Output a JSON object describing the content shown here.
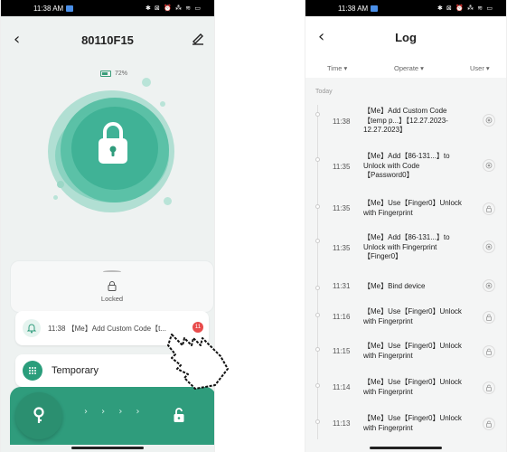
{
  "left": {
    "status": {
      "time": "11:38 AM",
      "icons": "✱ ⊠ ⏰ ⁂ ≋ ▭"
    },
    "header": {
      "title": "80110F15"
    },
    "battery": {
      "percent": "72%"
    },
    "lock_state": {
      "label": "Locked"
    },
    "latest_log": {
      "text": "11:38 【Me】Add Custom Code【t...",
      "badge": "11"
    },
    "temporary": {
      "label": "Temporary"
    },
    "unlock_bar": {
      "chevrons": "› › › ›"
    }
  },
  "right": {
    "status": {
      "time": "11:38 AM",
      "icons": "✱ ⊠ ⏰ ⁂ ≋ ▭"
    },
    "header": {
      "title": "Log"
    },
    "filters": {
      "time": "Time ▾",
      "operate": "Operate ▾",
      "user": "User ▾"
    },
    "section": "Today",
    "entries": [
      {
        "time": "11:38",
        "op": "【Me】Add Custom Code【temp p...】【12.27.2023-12.27.2023】",
        "icon": "record-icon"
      },
      {
        "time": "11:35",
        "op": "【Me】Add【86-131...】to Unlock with Code【Password0】",
        "icon": "record-icon"
      },
      {
        "time": "11:35",
        "op": "【Me】Use【Finger0】Unlock with Fingerprint",
        "icon": "unlock-icon"
      },
      {
        "time": "11:35",
        "op": "【Me】Add【86-131...】to Unlock with Fingerprint【Finger0】",
        "icon": "record-icon"
      },
      {
        "time": "11:31",
        "op": "【Me】Bind device",
        "icon": "record-icon"
      },
      {
        "time": "11:16",
        "op": "【Me】Use【Finger0】Unlock with Fingerprint",
        "icon": "unlock-icon"
      },
      {
        "time": "11:15",
        "op": "【Me】Use【Finger0】Unlock with Fingerprint",
        "icon": "unlock-icon"
      },
      {
        "time": "11:14",
        "op": "【Me】Use【Finger0】Unlock with Fingerprint",
        "icon": "unlock-icon"
      },
      {
        "time": "11:13",
        "op": "【Me】Use【Finger0】Unlock with Fingerprint",
        "icon": "unlock-icon"
      }
    ]
  }
}
